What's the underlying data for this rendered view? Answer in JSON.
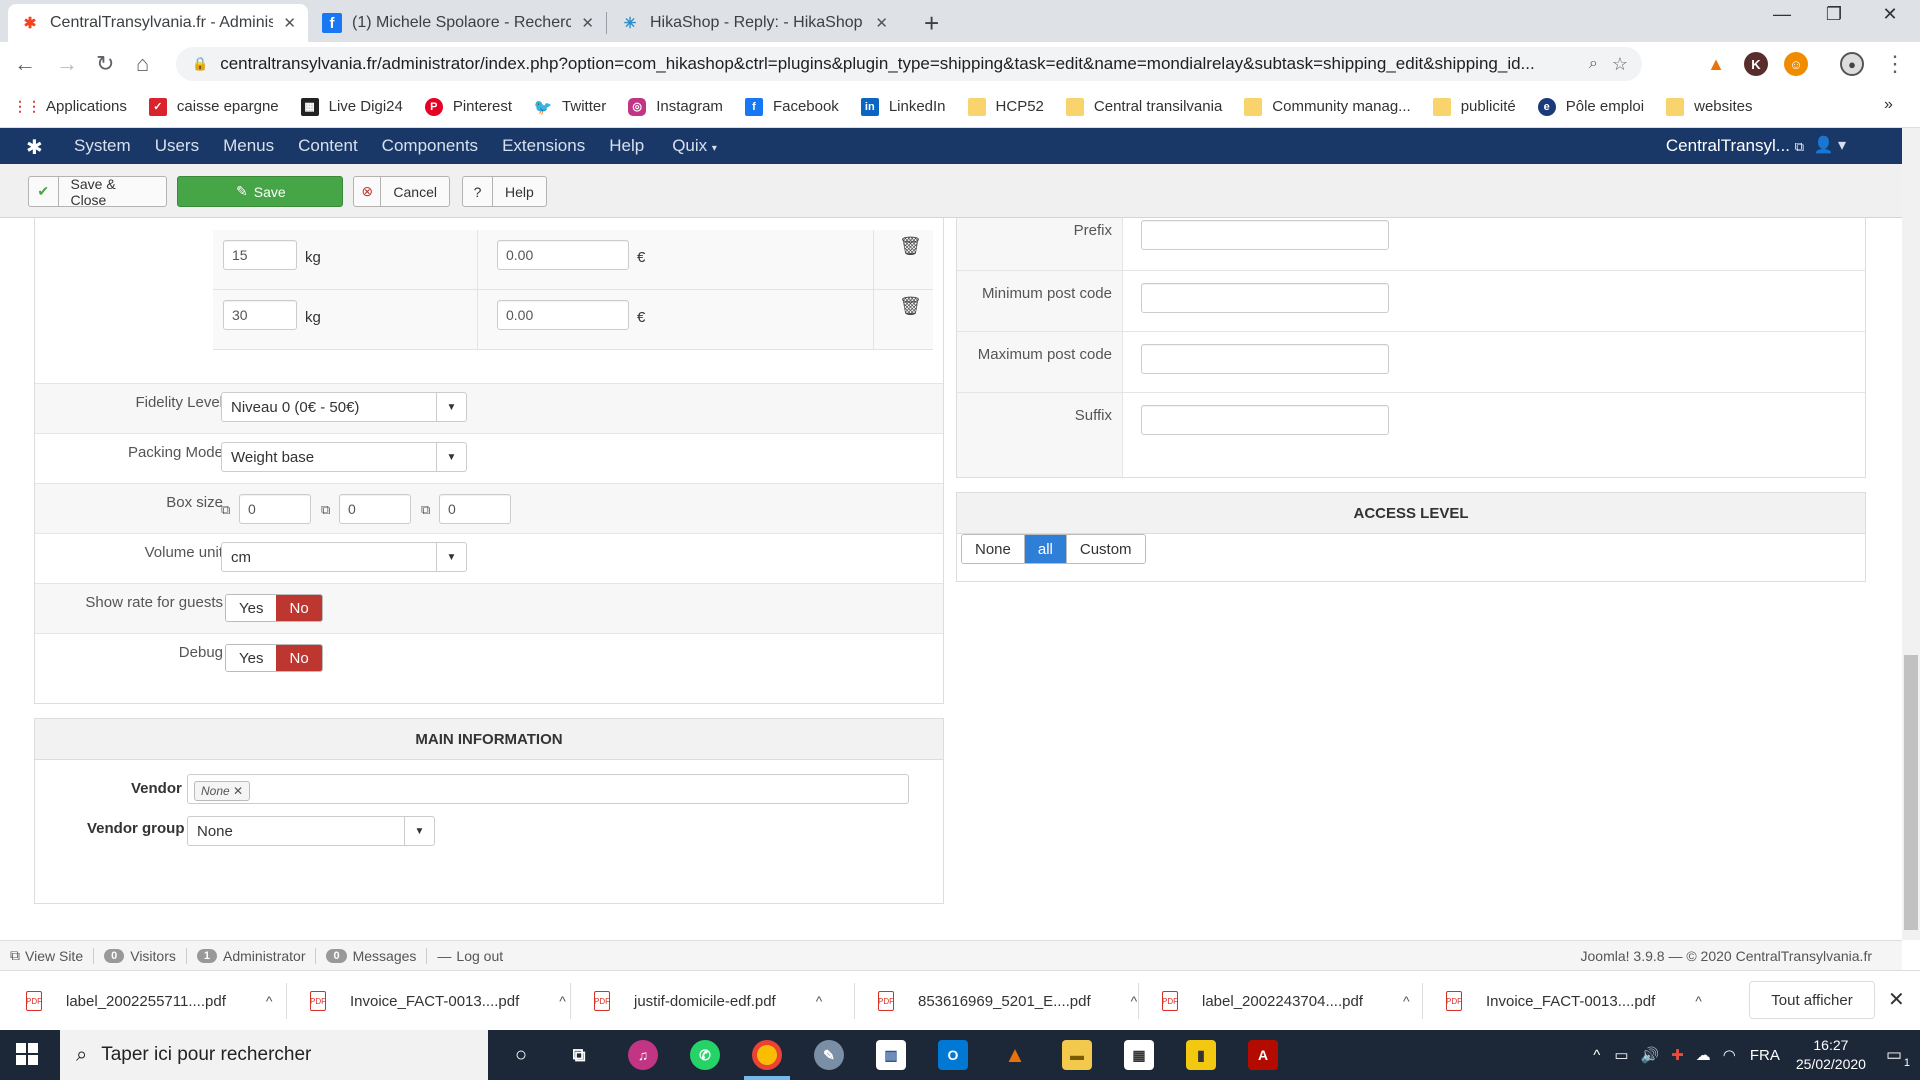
{
  "browser": {
    "tabs": [
      {
        "title": "CentralTransylvania.fr - Administr",
        "active": true
      },
      {
        "title": "(1) Michele Spolaore - Recherche",
        "active": false
      },
      {
        "title": "HikaShop - Reply: - HikaShop",
        "active": false
      }
    ],
    "url": "centraltransylvania.fr/administrator/index.php?option=com_hikashop&ctrl=plugins&plugin_type=shipping&task=edit&name=mondialrelay&subtask=shipping_edit&shipping_id...",
    "bookmarks": [
      "Applications",
      "caisse epargne",
      "Live Digi24",
      "Pinterest",
      "Twitter",
      "Instagram",
      "Facebook",
      "LinkedIn",
      "HCP52",
      "Central transilvania",
      "Community manag...",
      "publicité",
      "Pôle emploi",
      "websites"
    ],
    "more_bookmarks": "»"
  },
  "joomla": {
    "menu": [
      "System",
      "Users",
      "Menus",
      "Content",
      "Components",
      "Extensions",
      "Help",
      "Quix"
    ],
    "site_name": "CentralTransyl...",
    "toolbar": {
      "save_close": "Save & Close",
      "save": "Save",
      "cancel": "Cancel",
      "help": "Help"
    }
  },
  "weight_rows": [
    {
      "weight": "15",
      "unit": "kg",
      "price": "0.00",
      "currency": "€"
    },
    {
      "weight": "30",
      "unit": "kg",
      "price": "0.00",
      "currency": "€"
    }
  ],
  "form": {
    "fidelity_label": "Fidelity Level",
    "fidelity_value": "Niveau 0 (0€ - 50€)",
    "packing_label": "Packing Mode",
    "packing_value": "Weight base",
    "boxsize_label": "Box size",
    "box_x": "0",
    "box_y": "0",
    "box_z": "0",
    "volume_label": "Volume unit",
    "volume_value": "cm",
    "guests_label": "Show rate for guests",
    "debug_label": "Debug",
    "yes": "Yes",
    "no": "No"
  },
  "main_info": {
    "title": "MAIN INFORMATION",
    "vendor_label": "Vendor",
    "vendor_tag": "None",
    "vendor_group_label": "Vendor group",
    "vendor_group_value": "None"
  },
  "postcode": {
    "prefix_label": "Prefix",
    "min_label": "Minimum post code",
    "max_label": "Maximum post code",
    "suffix_label": "Suffix"
  },
  "access": {
    "title": "ACCESS LEVEL",
    "options": [
      "None",
      "all",
      "Custom"
    ],
    "selected": "all"
  },
  "statusbar": {
    "view_site": "View Site",
    "visitors_count": "0",
    "visitors": "Visitors",
    "admin_count": "1",
    "admin": "Administrator",
    "messages_count": "0",
    "messages": "Messages",
    "logout": "Log out",
    "version": "Joomla! 3.9.8 — © 2020 CentralTransylvania.fr"
  },
  "downloads": {
    "files": [
      "label_2002255711....pdf",
      "Invoice_FACT-0013....pdf",
      "justif-domicile-edf.pdf",
      "853616969_5201_E....pdf",
      "label_2002243704....pdf",
      "Invoice_FACT-0013....pdf"
    ],
    "show_all": "Tout afficher"
  },
  "taskbar": {
    "search_placeholder": "Taper ici pour rechercher",
    "lang": "FRA",
    "time": "16:27",
    "date": "25/02/2020",
    "notif_count": "1"
  },
  "colors": {
    "joomla_nav": "#1a3867",
    "save_green": "#46a546",
    "toggle_no_red": "#bd362f",
    "access_blue": "#2f7ed8"
  }
}
